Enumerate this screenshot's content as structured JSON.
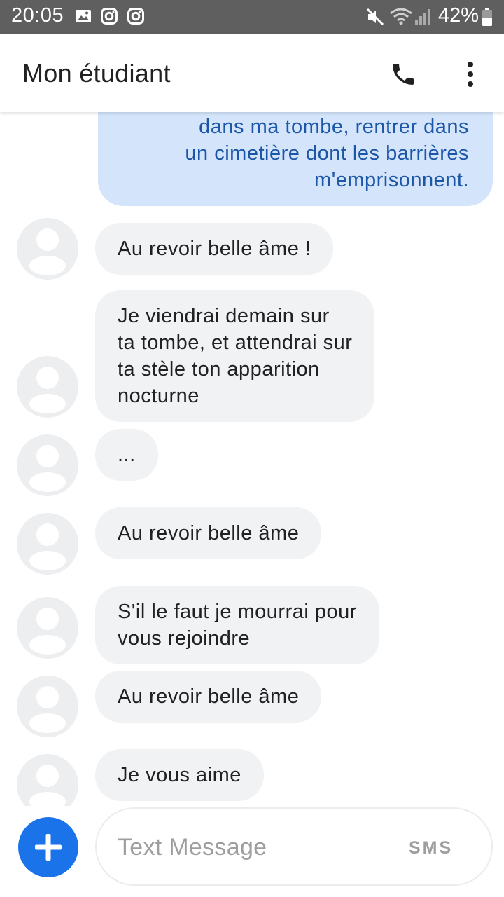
{
  "status_bar": {
    "time": "20:05",
    "battery": "42%",
    "icons": [
      "gallery-icon",
      "instagram-icon",
      "instagram-icon",
      "mute-icon",
      "wifi-icon",
      "signal-icon",
      "battery-icon"
    ]
  },
  "header": {
    "title": "Mon étudiant",
    "icons": [
      "phone-icon",
      "more-vert-icon"
    ]
  },
  "messages": [
    {
      "direction": "outgoing",
      "text": "dans ma tombe, rentrer dans\nun cimetière dont les barrières\nm'emprisonnent."
    },
    {
      "direction": "incoming",
      "text": "Au revoir belle âme !"
    },
    {
      "direction": "incoming",
      "text": "Je viendrai demain sur\nta tombe, et attendrai sur\nta stèle ton apparition\nnocturne"
    },
    {
      "direction": "incoming",
      "text": "..."
    },
    {
      "direction": "incoming",
      "text": "Au revoir belle âme"
    },
    {
      "direction": "incoming",
      "text": "S'il le faut je mourrai pour\nvous rejoindre"
    },
    {
      "direction": "incoming",
      "text": "Au revoir belle âme"
    },
    {
      "direction": "incoming",
      "text": "Je vous aime"
    }
  ],
  "compose": {
    "placeholder": "Text Message",
    "send_mode": "SMS",
    "add_icon": "plus-icon"
  },
  "colors": {
    "status_bar": "#5f5f5f",
    "outgoing_bubble": "#d4e4fb",
    "outgoing_text": "#1c56a8",
    "incoming_bubble": "#f1f2f4",
    "accent": "#1a73e8"
  }
}
